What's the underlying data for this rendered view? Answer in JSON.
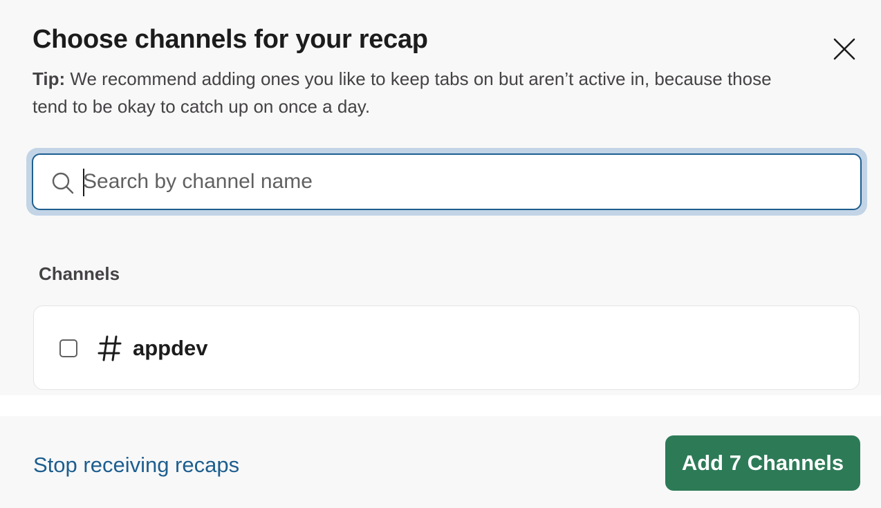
{
  "modal": {
    "title": "Choose channels for your recap",
    "close_icon": "close-icon",
    "tip_label": "Tip:",
    "tip_text": "We recommend adding ones you like to keep tabs on but aren’t active in, because those tend to be okay to catch up on once a day."
  },
  "search": {
    "icon": "search-icon",
    "placeholder": "Search by channel name",
    "value": ""
  },
  "channels": {
    "section_label": "Channels",
    "items": [
      {
        "name": "appdev",
        "checked": false,
        "icon": "hash-icon"
      }
    ]
  },
  "footer": {
    "stop_label": "Stop receiving recaps",
    "add_label": "Add 7 Channels"
  },
  "colors": {
    "accent": "#1d5e8f",
    "primary_button": "#2d7a57",
    "focus_ring": "#c2d4e6"
  }
}
